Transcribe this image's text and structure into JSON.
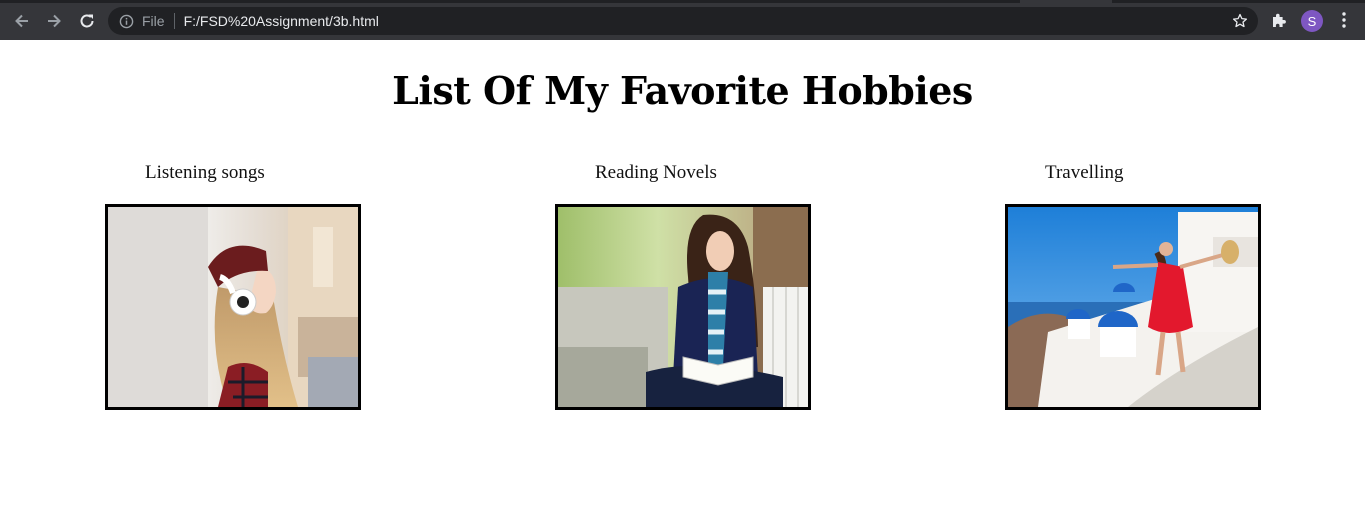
{
  "browser": {
    "scheme_label": "File",
    "url": "F:/FSD%20Assignment/3b.html",
    "profile_initial": "S"
  },
  "page": {
    "title": "List Of My Favorite Hobbies",
    "hobbies": [
      {
        "caption": "Listening songs"
      },
      {
        "caption": "Reading Novels"
      },
      {
        "caption": "Travelling"
      }
    ]
  }
}
